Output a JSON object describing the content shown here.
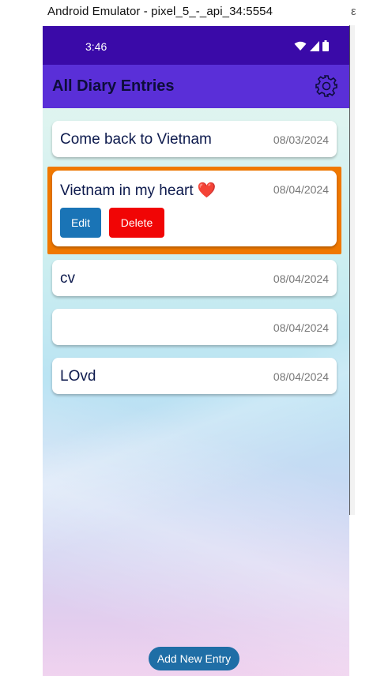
{
  "window": {
    "title": "Android Emulator - pixel_5_-_api_34:5554",
    "title_fragment": "ε"
  },
  "status_bar": {
    "time": "3:46",
    "icons": [
      "wifi-icon",
      "signal-icon",
      "battery-icon"
    ]
  },
  "app_bar": {
    "title": "All Diary Entries",
    "settings_icon": "gear-icon"
  },
  "entries": [
    {
      "title": "Come back to Vietnam",
      "date": "08/03/2024"
    },
    {
      "title": "Vietnam in my heart ❤️",
      "date": "08/04/2024",
      "selected": true
    },
    {
      "title": "cv",
      "date": "08/04/2024"
    },
    {
      "title": "",
      "date": "08/04/2024"
    },
    {
      "title": "LOvd",
      "date": "08/04/2024"
    }
  ],
  "actions": {
    "edit_label": "Edit",
    "delete_label": "Delete"
  },
  "add_entry_label": "Add New Entry",
  "colors": {
    "status_bar": "#3a0aa8",
    "app_bar": "#5a2fd8",
    "highlight": "#f07800",
    "edit_button": "#1a74b6",
    "delete_button": "#f10505",
    "add_button": "#1f6ea6"
  }
}
